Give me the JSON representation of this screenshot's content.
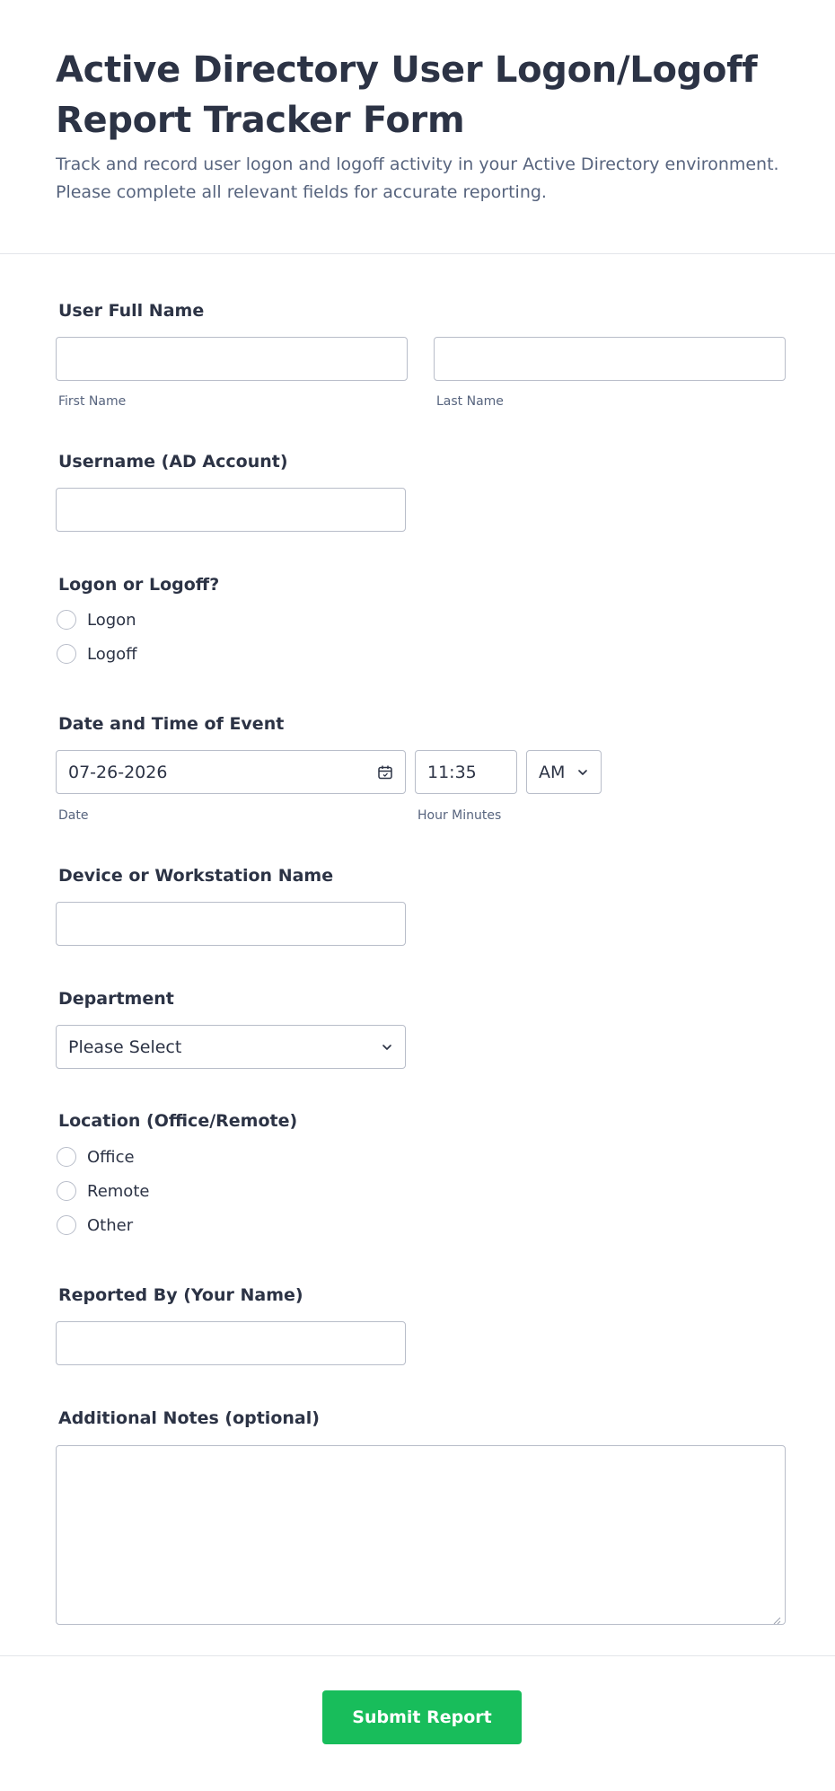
{
  "form": {
    "title": "Active Directory User Logon/Logoff Report Tracker Form",
    "description": "Track and record user logon and logoff activity in your Active Directory environment. Please complete all relevant fields for accurate reporting."
  },
  "fields": {
    "full_name": {
      "label": "User Full Name",
      "first_sublabel": "First Name",
      "last_sublabel": "Last Name",
      "first_value": "",
      "last_value": ""
    },
    "username": {
      "label": "Username (AD Account)",
      "value": ""
    },
    "logon_logoff": {
      "label": "Logon or Logoff?",
      "options": [
        "Logon",
        "Logoff"
      ]
    },
    "datetime": {
      "label": "Date and Time of Event",
      "date_value": "07-26-2026",
      "date_sublabel": "Date",
      "time_value": "11:35",
      "time_sublabel": "Hour Minutes",
      "ampm_value": "AM"
    },
    "device": {
      "label": "Device or Workstation Name",
      "value": ""
    },
    "department": {
      "label": "Department",
      "selected": "Please Select"
    },
    "location": {
      "label": "Location (Office/Remote)",
      "options": [
        "Office",
        "Remote",
        "Other"
      ]
    },
    "reported_by": {
      "label": "Reported By (Your Name)",
      "value": ""
    },
    "notes": {
      "label": "Additional Notes (optional)",
      "value": ""
    }
  },
  "submit": {
    "label": "Submit Report"
  },
  "colors": {
    "accent": "#18bd5b",
    "text": "#2c3345",
    "subtext": "#57647e",
    "border": "#b8bdc9"
  },
  "icons": {
    "calendar": "calendar-icon",
    "chevron": "chevron-down-icon"
  }
}
